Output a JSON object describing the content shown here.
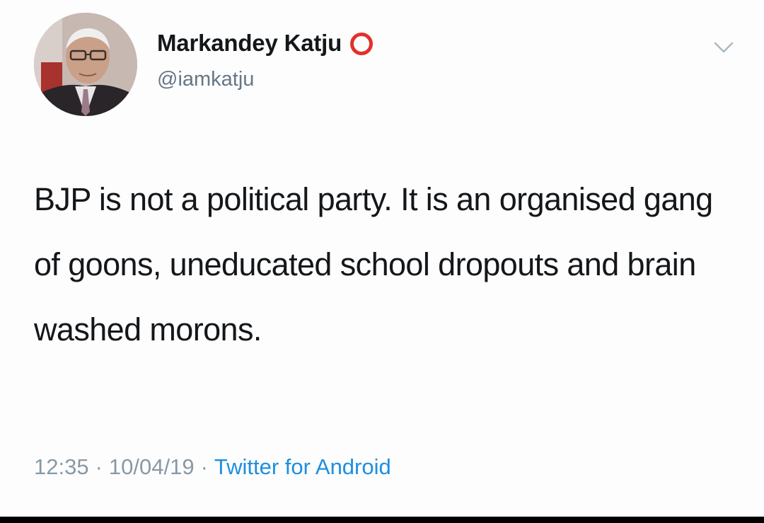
{
  "tweet": {
    "display_name": "Markandey Katju",
    "handle": "@iamkatju",
    "text": "BJP is not a political party. It is an organised gang of goons, uneducated school dropouts and brain washed morons.",
    "time": "12:35",
    "separator": "·",
    "date": "10/04/19",
    "source": "Twitter for Android"
  },
  "icons": {
    "name_badge": "red-ring-icon",
    "menu": "chevron-down-icon",
    "avatar": "profile-photo"
  },
  "colors": {
    "name_text": "#14171a",
    "secondary_text": "#657786",
    "link": "#1d8fe0",
    "badge_ring": "#e0322b"
  }
}
